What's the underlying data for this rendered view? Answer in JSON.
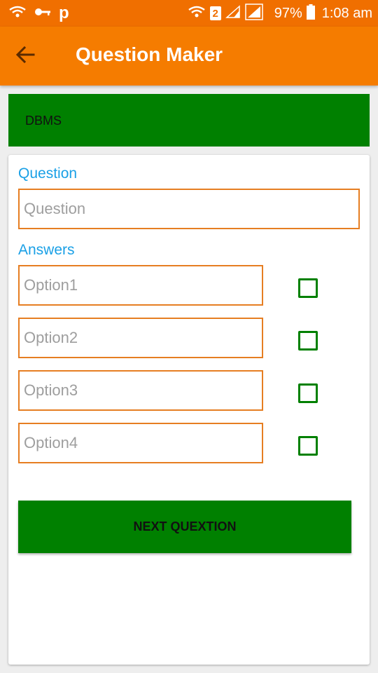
{
  "status_bar": {
    "carrier_logo": "p",
    "sim_number": "2",
    "battery": "97%",
    "time": "1:08 am"
  },
  "app_bar": {
    "title": "Question Maker",
    "back_icon": "arrow-left-icon"
  },
  "subject": {
    "label": "DBMS"
  },
  "form": {
    "question_label": "Question",
    "question_placeholder": "Question",
    "answers_label": "Answers",
    "options": [
      {
        "placeholder": "Option1",
        "checked": false
      },
      {
        "placeholder": "Option2",
        "checked": false
      },
      {
        "placeholder": "Option3",
        "checked": false
      },
      {
        "placeholder": "Option4",
        "checked": false
      }
    ],
    "next_button_label": "NEXT QUEXTION"
  },
  "colors": {
    "status_bar": "#f06f00",
    "app_bar": "#f57c00",
    "accent_green": "#008000",
    "label_blue": "#1aa0e6",
    "field_border": "#e67e22"
  }
}
